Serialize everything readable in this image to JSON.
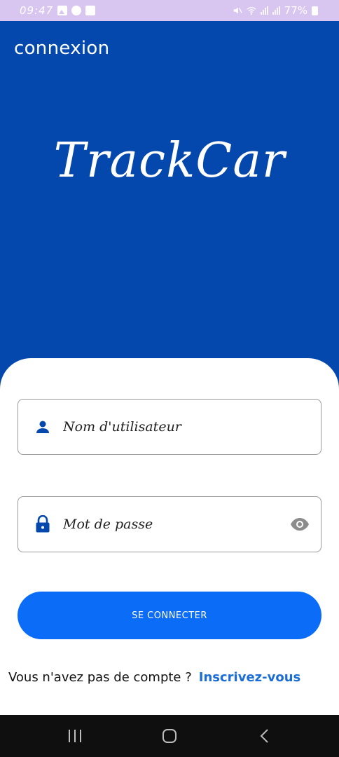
{
  "status_bar": {
    "time": "09:47",
    "battery": "77%"
  },
  "header": {
    "title": "connexion",
    "brand": "TrackCar"
  },
  "form": {
    "username": {
      "placeholder": "Nom d'utilisateur",
      "value": "",
      "icon": "person-icon"
    },
    "password": {
      "placeholder": "Mot de passe",
      "value": "",
      "icon": "lock-icon",
      "toggle_icon": "eye-icon"
    },
    "submit_label": "SE CONNECTER"
  },
  "signup": {
    "question": "Vous n'avez pas de compte ?",
    "link_label": "Inscrivez-vous"
  },
  "colors": {
    "primary": "#0447ad",
    "button": "#0a6cf7",
    "link": "#1a6cd6",
    "status_bar": "#d8c5f0"
  }
}
